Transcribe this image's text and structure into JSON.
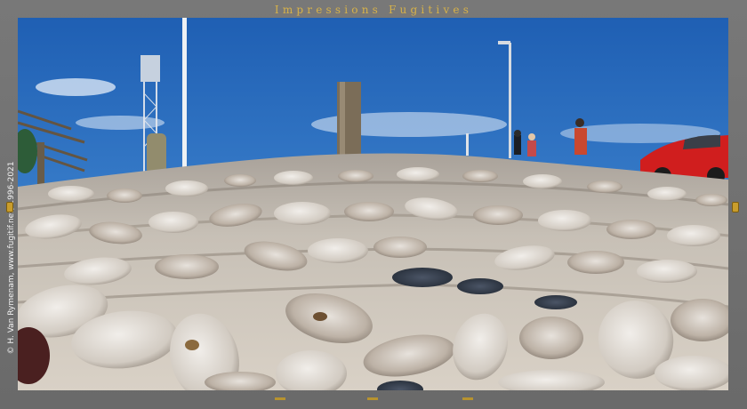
{
  "header": {
    "site_title": "Impressions Fugitives"
  },
  "photo": {
    "credit": "© H. Van Rymenam, www.fugitif.net, 1996-2021",
    "subject": "oyster shells",
    "colors": {
      "sky": "#2a6bbd",
      "shell": "#d9d4cc",
      "frame": "#6f6f6f",
      "accent": "#d7b24a"
    }
  },
  "navigation": {
    "prev_icon": "left-tab-icon",
    "next_icon": "right-tab-icon"
  }
}
